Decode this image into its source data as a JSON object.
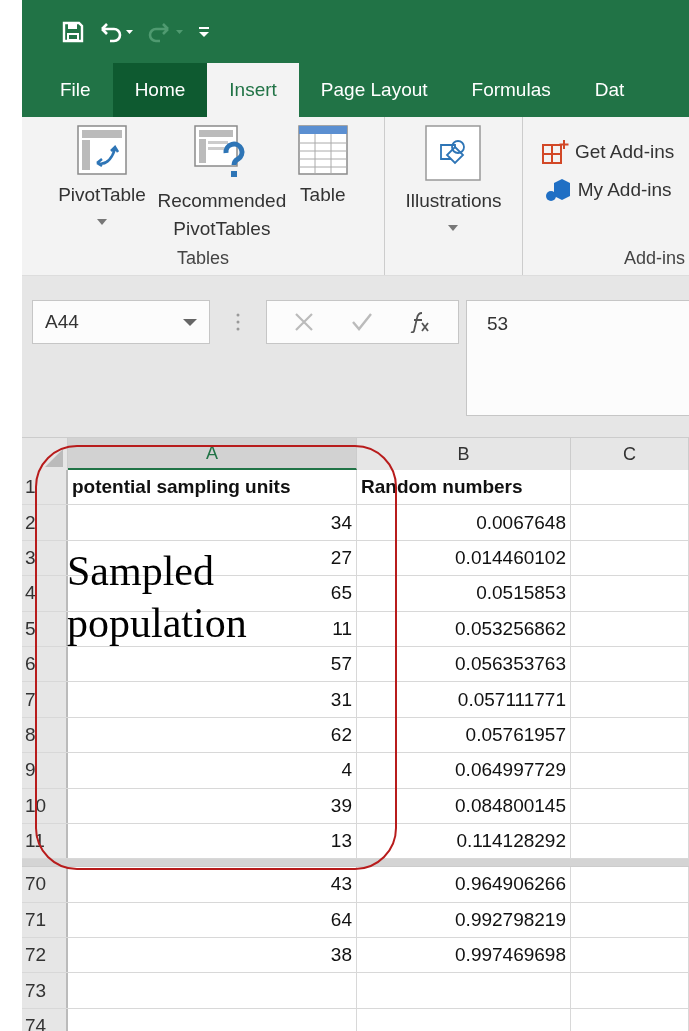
{
  "quick_access": [
    {
      "kind": "save",
      "disabled": false
    },
    {
      "kind": "undo",
      "disabled": false
    },
    {
      "kind": "redo",
      "disabled": true
    },
    {
      "kind": "customize",
      "disabled": false
    }
  ],
  "tabs": [
    {
      "label": "File",
      "selected": false,
      "highlighted": false
    },
    {
      "label": "Home",
      "selected": false,
      "highlighted": true
    },
    {
      "label": "Insert",
      "selected": true,
      "highlighted": false
    },
    {
      "label": "Page Layout",
      "selected": false,
      "highlighted": false
    },
    {
      "label": "Formulas",
      "selected": false,
      "highlighted": false
    },
    {
      "label": "Dat",
      "selected": false,
      "highlighted": false
    }
  ],
  "ribbon_groups": [
    {
      "label": "Tables",
      "commands": [
        {
          "kind": "pivot",
          "label": "PivotTable",
          "dropdown": true
        },
        {
          "kind": "recommended",
          "label": "Recommended PivotTables",
          "dropdown": false
        },
        {
          "kind": "table",
          "label": "Table",
          "dropdown": false
        }
      ]
    },
    {
      "commands": [
        {
          "kind": "shapes",
          "label": "Illustrations",
          "dropdown": true
        }
      ]
    },
    {
      "label": "Add-ins",
      "commands": [
        {
          "kind": "get",
          "label": "Get Add-ins",
          "dropdown": false
        },
        {
          "kind": "my",
          "label": "My Add-ins",
          "dropdown": false
        }
      ]
    }
  ],
  "name_box": "A44",
  "formula": "53",
  "columns": [
    {
      "label": "A",
      "selected": true
    },
    {
      "label": "B",
      "selected": false
    },
    {
      "label": "C",
      "selected": false
    }
  ],
  "header_row": {
    "number": "1",
    "a": "potential sampling units",
    "b": "Random numbers"
  },
  "row_groups": [
    [
      {
        "number": "2",
        "a": "34",
        "b": "0.0067648"
      },
      {
        "number": "3",
        "a": "27",
        "b": "0.014460102"
      },
      {
        "number": "4",
        "a": "65",
        "b": "0.0515853"
      },
      {
        "number": "5",
        "a": "11",
        "b": "0.053256862"
      },
      {
        "number": "6",
        "a": "57",
        "b": "0.056353763"
      },
      {
        "number": "7",
        "a": "31",
        "b": "0.057111771"
      },
      {
        "number": "8",
        "a": "62",
        "b": "0.05761957"
      },
      {
        "number": "9",
        "a": "4",
        "b": "0.064997729"
      },
      {
        "number": "10",
        "a": "39",
        "b": "0.084800145"
      },
      {
        "number": "11",
        "a": "13",
        "b": "0.114128292"
      }
    ],
    [
      {
        "number": "70",
        "a": "43",
        "b": "0.964906266"
      },
      {
        "number": "71",
        "a": "64",
        "b": "0.992798219"
      },
      {
        "number": "72",
        "a": "38",
        "b": "0.997469698"
      },
      {
        "number": "73"
      },
      {
        "number": "74"
      }
    ]
  ],
  "annotation": {
    "text": "Sampled population"
  }
}
